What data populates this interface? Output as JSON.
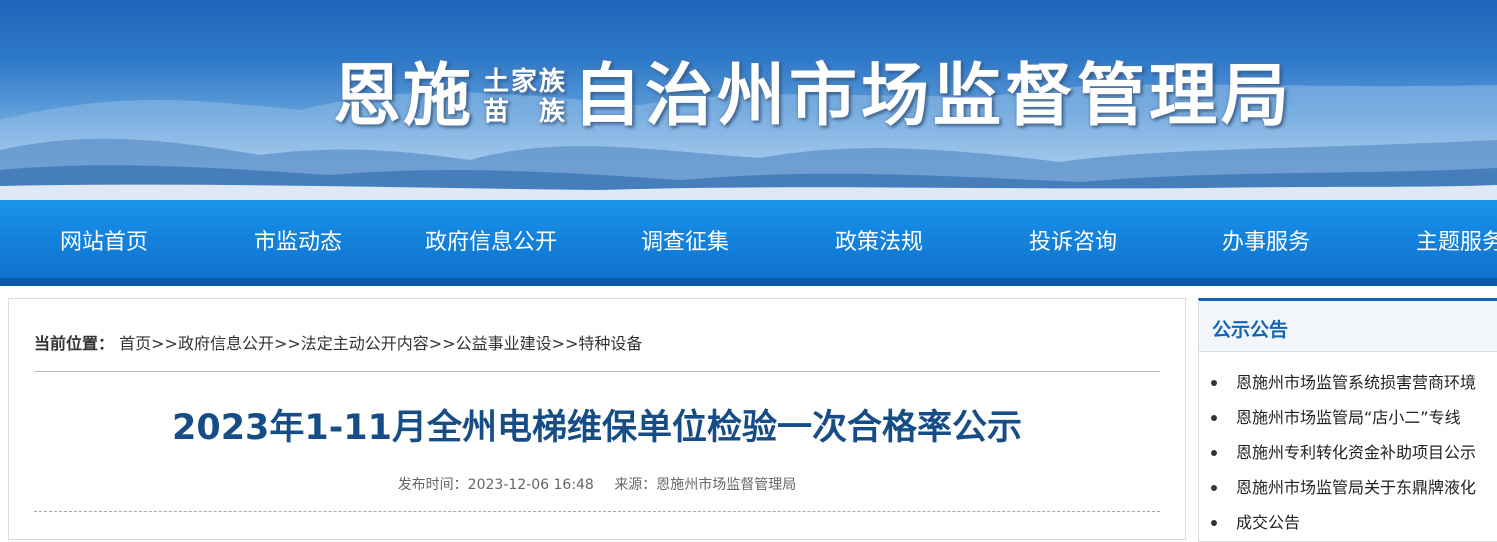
{
  "banner": {
    "title_part1": "恩施",
    "small_line1": "土家族",
    "small_line2_a": "苗",
    "small_line2_b": "族",
    "title_part2": "自治州市场监督管理局"
  },
  "nav": {
    "items": [
      "网站首页",
      "市监动态",
      "政府信息公开",
      "调查征集",
      "政策法规",
      "投诉咨询",
      "办事服务",
      "主题服务"
    ]
  },
  "breadcrumb": {
    "label": "当前位置：",
    "items": [
      "首页",
      "政府信息公开",
      "法定主动公开内容",
      "公益事业建设",
      "特种设备"
    ],
    "separator": ">>"
  },
  "article": {
    "title": "2023年1-11月全州电梯维保单位检验一次合格率公示",
    "publish_time": "发布时间：2023-12-06 16:48",
    "source": "来源：恩施州市场监督管理局"
  },
  "side": {
    "title": "公示公告",
    "items": [
      "恩施州市场监管系统损害营商环境",
      "恩施州市场监管局“店小二”专线",
      "恩施州专利转化资金补助项目公示",
      "恩施州市场监管局关于东鼎牌液化",
      "成交公告"
    ]
  },
  "colors": {
    "nav_blue": "#1482dc",
    "title_blue": "#174d86",
    "side_accent": "#1064b8"
  }
}
